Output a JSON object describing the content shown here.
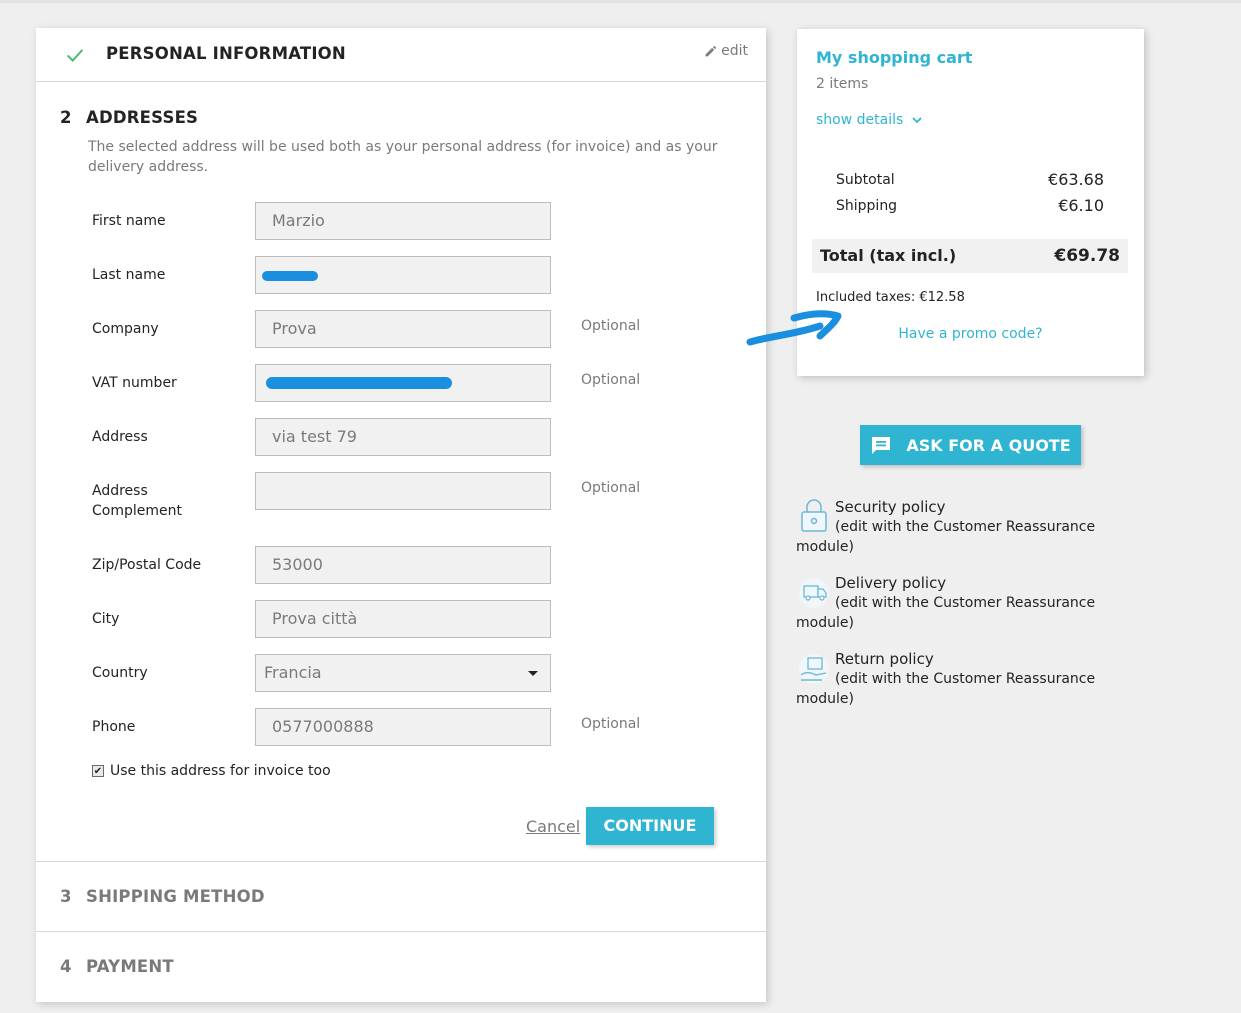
{
  "checkout": {
    "personal": {
      "title": "Personal Information",
      "edit": "edit"
    },
    "addresses": {
      "number": "2",
      "title": "Addresses",
      "intro": "The selected address will be used both as your personal address (for invoice) and as your delivery address.",
      "fields": {
        "first_name": {
          "label": "First name",
          "value": "Marzio"
        },
        "last_name": {
          "label": "Last name",
          "value": ""
        },
        "company": {
          "label": "Company",
          "value": "Prova",
          "optional": "Optional"
        },
        "vat": {
          "label": "VAT number",
          "value": "",
          "optional": "Optional"
        },
        "address": {
          "label": "Address",
          "value": "via test 79"
        },
        "complement": {
          "label": "Address Complement",
          "value": "",
          "optional": "Optional"
        },
        "zip": {
          "label": "Zip/Postal Code",
          "value": "53000"
        },
        "city": {
          "label": "City",
          "value": "Prova città"
        },
        "country": {
          "label": "Country",
          "value": "Francia"
        },
        "phone": {
          "label": "Phone",
          "value": "0577000888",
          "optional": "Optional"
        }
      },
      "invoice_checkbox": {
        "label": "Use this address for invoice too",
        "checked": true
      },
      "cancel": "Cancel",
      "continue": "Continue"
    },
    "shipping": {
      "number": "3",
      "title": "Shipping Method"
    },
    "payment": {
      "number": "4",
      "title": "Payment"
    }
  },
  "cart": {
    "title": "My shopping cart",
    "count": "2 items",
    "show_details": "show details",
    "subtotal_label": "Subtotal",
    "subtotal": "€63.68",
    "shipping_label": "Shipping",
    "shipping": "€6.10",
    "total_label": "Total (tax incl.)",
    "total": "€69.78",
    "taxes": "Included taxes: €12.58",
    "promo": "Have a promo code?"
  },
  "quote_button": "Ask for a quote",
  "reassurance": [
    {
      "title": "Security policy",
      "desc": "(edit with the Customer Reassurance module)",
      "icon": "lock-icon"
    },
    {
      "title": "Delivery policy",
      "desc": "(edit with the Customer Reassurance module)",
      "icon": "truck-icon"
    },
    {
      "title": "Return policy",
      "desc": "(edit with the Customer Reassurance module)",
      "icon": "return-box-icon"
    }
  ],
  "colors": {
    "accent": "#2fb5d2",
    "success": "#4cbb6c",
    "scribble": "#1a8fe0"
  }
}
